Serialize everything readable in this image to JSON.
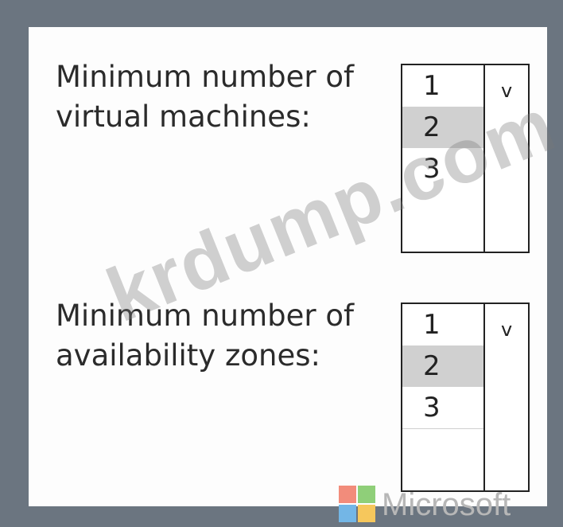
{
  "questions": [
    {
      "label": "Minimum number of virtual machines:",
      "options": [
        "1",
        "2",
        "3"
      ],
      "selected": "2"
    },
    {
      "label": "Minimum number of availability zones:",
      "options": [
        "1",
        "2",
        "3"
      ],
      "selected": "2"
    }
  ],
  "watermark": "krdump.com",
  "branding": {
    "logo_text": "Microsoft"
  },
  "icons": {
    "dropdown_arrow": "chevron-down-icon"
  },
  "colors": {
    "frame": "#6b7580",
    "selected_option": "#d0d0d0",
    "logo_red": "#f28c7b",
    "logo_green": "#8fcf79",
    "logo_blue": "#73b6e6",
    "logo_yellow": "#f6c75c"
  }
}
